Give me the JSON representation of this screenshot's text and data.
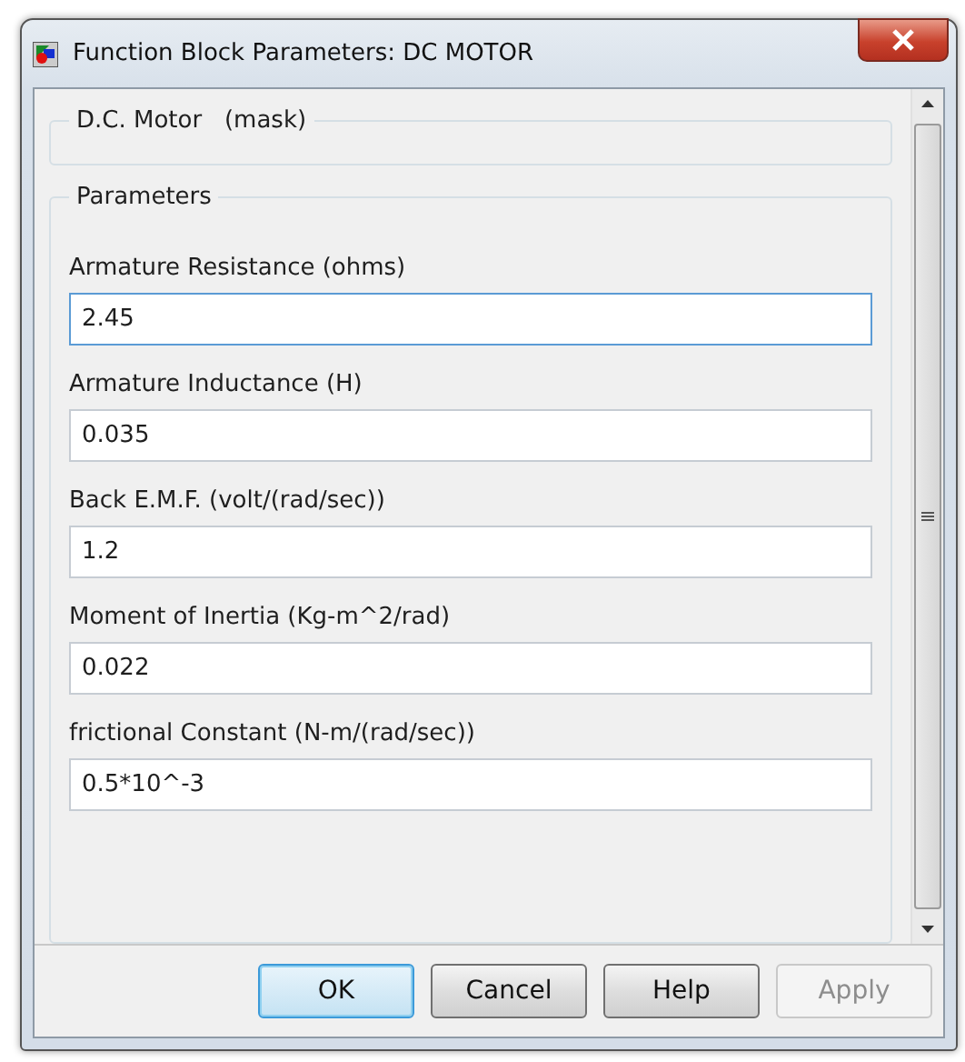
{
  "window": {
    "title": "Function Block Parameters: DC MOTOR"
  },
  "mask": {
    "title": "D.C. Motor",
    "suffix": "(mask)"
  },
  "parameters": {
    "title": "Parameters",
    "fields": [
      {
        "label": "Armature Resistance (ohms)",
        "value": "2.45",
        "focused": true
      },
      {
        "label": "Armature Inductance (H)",
        "value": "0.035",
        "focused": false
      },
      {
        "label": "Back E.M.F. (volt/(rad/sec))",
        "value": "1.2",
        "focused": false
      },
      {
        "label": "Moment of Inertia (Kg-m^2/rad)",
        "value": "0.022",
        "focused": false
      },
      {
        "label": "frictional Constant (N-m/(rad/sec))",
        "value": "0.5*10^-3",
        "focused": false
      }
    ]
  },
  "buttons": [
    {
      "label": "OK",
      "default": true,
      "disabled": false
    },
    {
      "label": "Cancel",
      "default": false,
      "disabled": false
    },
    {
      "label": "Help",
      "default": false,
      "disabled": false
    },
    {
      "label": "Apply",
      "default": false,
      "disabled": true
    }
  ]
}
